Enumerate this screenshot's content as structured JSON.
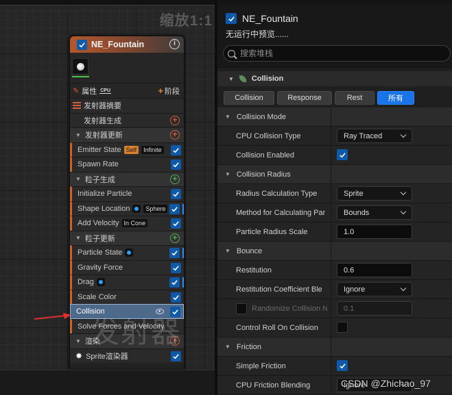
{
  "canvas": {
    "zoom_label": "缩放1:1"
  },
  "node": {
    "title": "NE_Fountain",
    "properties_label": "属性",
    "cpu_badge": "CPU",
    "stage_label": "阶段",
    "summary_label": "发射器摘要",
    "emitter_spawn": "发射器生成",
    "emitter_update": "发射器更新",
    "emitter_state": "Emitter State",
    "chip_self": "Self",
    "chip_infinite": "Infinite",
    "spawn_rate": "Spawn Rate",
    "particle_spawn": "粒子生成",
    "initialize_particle": "Initialize Particle",
    "shape_location": "Shape Location",
    "chip_sphere": "Sphere",
    "add_velocity": "Add Velocity",
    "chip_in_cone": "In Cone",
    "particle_update": "粒子更新",
    "particle_state": "Particle State",
    "gravity_force": "Gravity Force",
    "drag": "Drag",
    "scale_color": "Scale Color",
    "collision": "Collision",
    "solve_forces": "Solve Forces and Velocity",
    "render": "渲染",
    "sprite_renderer": "Sprite渲染器"
  },
  "watermark_text": "发射器",
  "panel": {
    "title": "NE_Fountain",
    "subtitle": "无运行中预览......",
    "search_placeholder": "搜索堆栈",
    "section_title": "Collision",
    "tabs": [
      "Collision",
      "Response",
      "Rest",
      "所有"
    ],
    "active_tab": "所有",
    "categories": {
      "collision_mode": "Collision Mode",
      "collision_radius": "Collision Radius",
      "bounce": "Bounce",
      "friction": "Friction"
    },
    "props": {
      "cpu_collision_type": {
        "label": "CPU Collision Type",
        "value": "Ray Traced"
      },
      "collision_enabled": {
        "label": "Collision Enabled",
        "checked": true
      },
      "radius_calc_type": {
        "label": "Radius Calculation Type",
        "value": "Sprite"
      },
      "method_calc": {
        "label": "Method for Calculating Par",
        "value": "Bounds"
      },
      "particle_radius_scale": {
        "label": "Particle Radius Scale",
        "value": "1.0"
      },
      "restitution": {
        "label": "Restitution",
        "value": "0.6"
      },
      "restitution_coeff": {
        "label": "Restitution Coefficient Ble",
        "value": "Ignore"
      },
      "randomize_collision": {
        "label": "Randomize Collision N",
        "value": "0.1"
      },
      "control_roll": {
        "label": "Control Roll On Collision",
        "checked": false
      },
      "simple_friction": {
        "label": "Simple Friction",
        "checked": true
      },
      "cpu_friction_blending": {
        "label": "CPU Friction Blending",
        "value": "Ignore"
      }
    }
  },
  "csdn_watermark": "CSDN @Zhichao_97"
}
